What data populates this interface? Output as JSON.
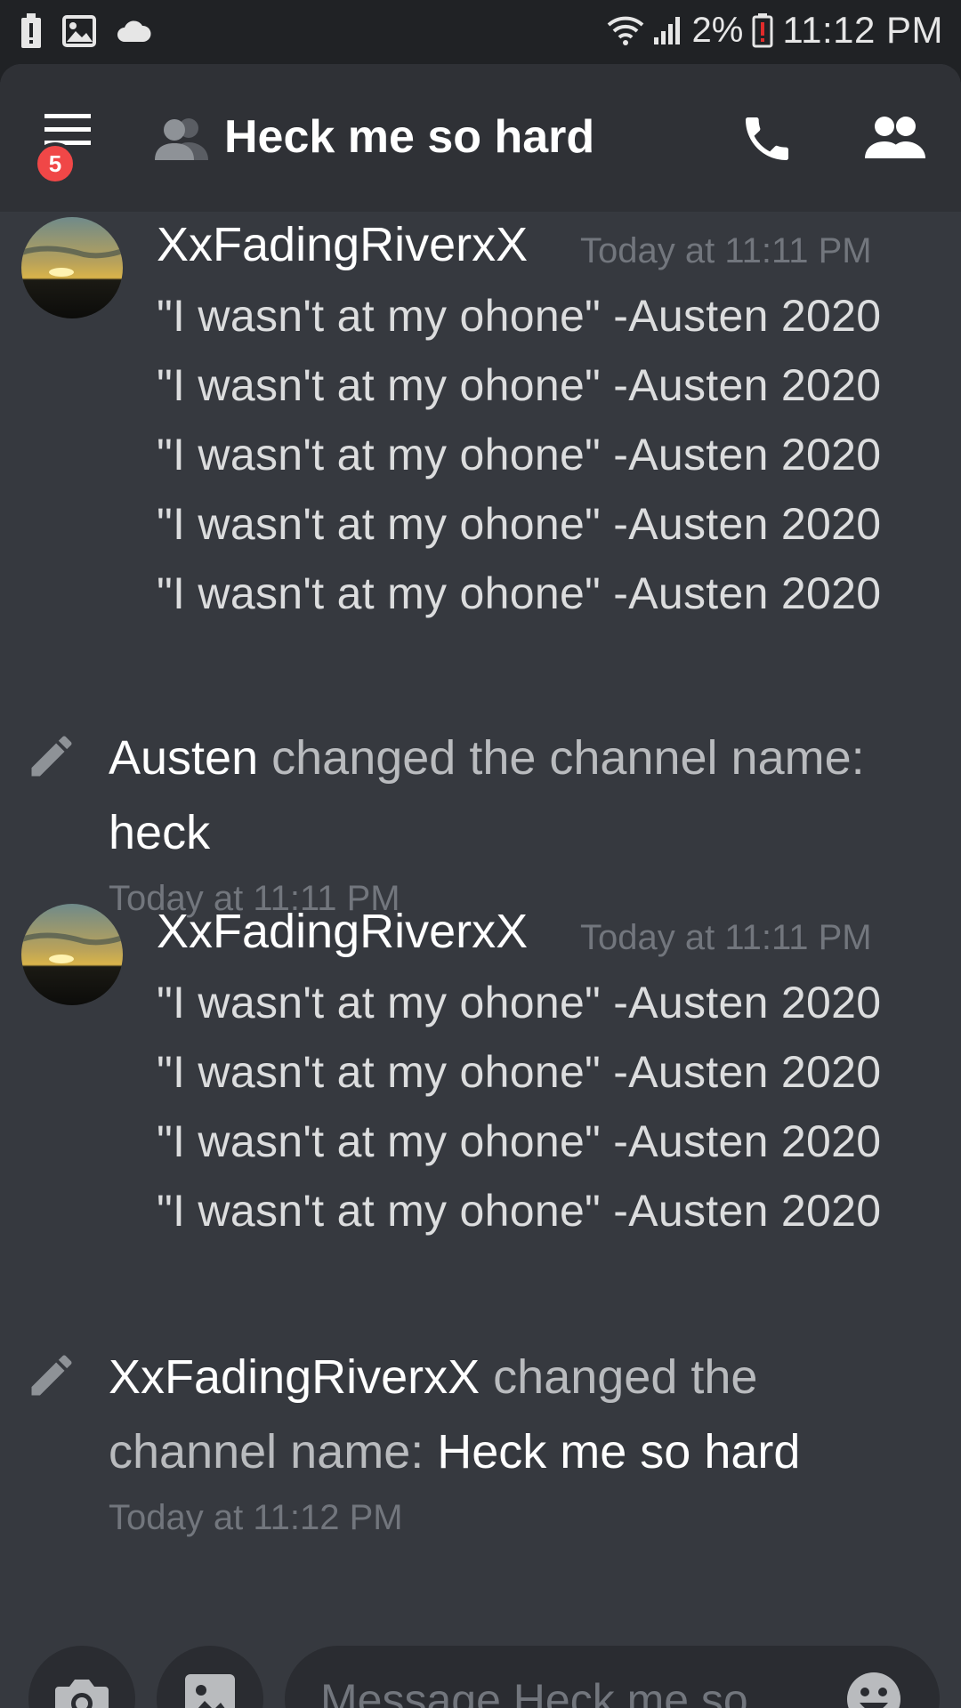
{
  "status_bar": {
    "battery_percent": "2%",
    "time": "11:12 PM",
    "left_icons": [
      "battery-alert-icon",
      "image-icon",
      "cloud-icon"
    ],
    "right_icons": [
      "wifi-icon",
      "signal-icon",
      "battery-low-icon"
    ]
  },
  "header": {
    "unread_badge": "5",
    "channel_name": "Heck me so hard",
    "icons": [
      "menu-icon",
      "group-dm-icon",
      "phone-icon",
      "members-icon"
    ]
  },
  "messages": [
    {
      "author": "XxFadingRiverxX",
      "timestamp": "Today at 11:11 PM",
      "lines": [
        "\"I wasn't at my ohone\" -Austen 2020",
        "\"I wasn't at my ohone\" -Austen 2020",
        "\"I wasn't at my ohone\" -Austen 2020",
        "\"I wasn't at my ohone\" -Austen 2020",
        "\"I wasn't at my ohone\" -Austen 2020"
      ]
    },
    {
      "author": "XxFadingRiverxX",
      "timestamp": "Today at 11:11 PM",
      "lines": [
        "\"I wasn't at my ohone\" -Austen 2020",
        "\"I wasn't at my ohone\" -Austen 2020",
        "\"I wasn't at my ohone\" -Austen 2020",
        "\"I wasn't at my ohone\" -Austen 2020"
      ]
    }
  ],
  "system_messages": [
    {
      "actor": "Austen",
      "action": " changed the channel name: ",
      "new_name": "heck",
      "timestamp": "Today at 11:11 PM"
    },
    {
      "actor": "XxFadingRiverxX",
      "action": " changed the channel name: ",
      "new_name": "Heck me so hard",
      "timestamp": "Today at 11:12 PM"
    }
  ],
  "composer": {
    "placeholder": "Message Heck me so ...",
    "icons": [
      "camera-icon",
      "image-icon",
      "emoji-icon"
    ]
  },
  "colors": {
    "background": "#36393f",
    "header": "#2f3136",
    "badge": "#f04747",
    "text": "#dcddde",
    "muted": "#72767d"
  }
}
